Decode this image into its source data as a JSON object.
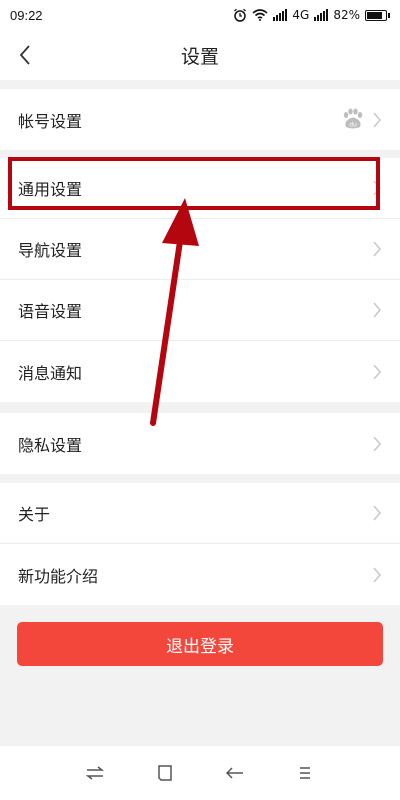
{
  "status_bar": {
    "time": "09:22",
    "network": "4G",
    "battery": "82%",
    "battery_level": 0.82
  },
  "header": {
    "title": "设置",
    "back_icon": "chevron-left-icon"
  },
  "groups": [
    {
      "items": [
        {
          "label": "帐号设置",
          "badge_icon": "baidu-paw-icon"
        }
      ]
    },
    {
      "items": [
        {
          "label": "通用设置"
        },
        {
          "label": "导航设置"
        },
        {
          "label": "语音设置"
        },
        {
          "label": "消息通知"
        }
      ]
    },
    {
      "items": [
        {
          "label": "隐私设置"
        }
      ]
    },
    {
      "items": [
        {
          "label": "关于"
        },
        {
          "label": "新功能介绍"
        }
      ]
    }
  ],
  "logout": {
    "label": "退出登录"
  },
  "annotation": {
    "color": "#b4060e",
    "highlighted_item": "通用设置"
  },
  "colors": {
    "logout_button": "#f3473b",
    "background": "#f2f2f2"
  },
  "bottom_nav": {
    "icons": [
      "swap-icon",
      "square-icon",
      "back-arrow-icon",
      "menu-icon"
    ]
  }
}
